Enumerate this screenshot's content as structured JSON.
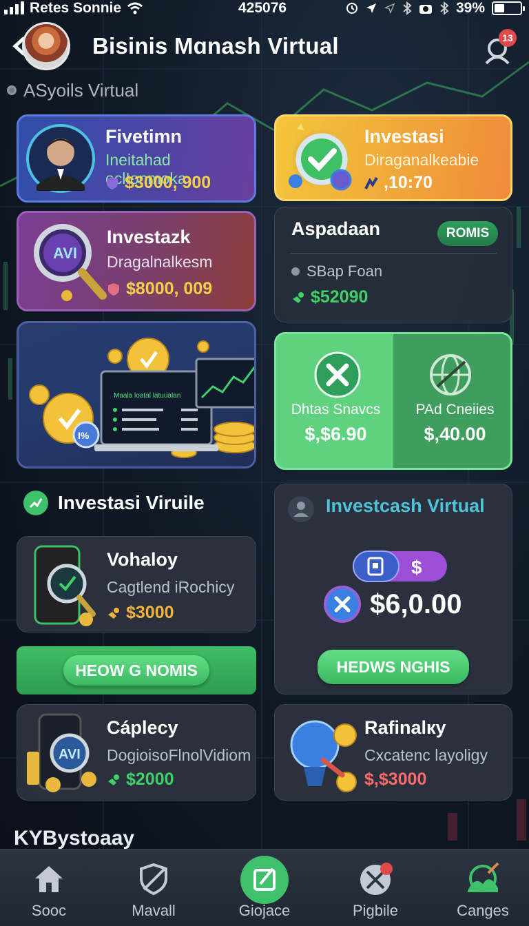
{
  "status_bar": {
    "carrier": "Retes Sonnie",
    "center": "425076",
    "battery": "39%",
    "battery_level": 0.39
  },
  "header": {
    "title": "Bisinis Mɑnash Virtual",
    "notification_count": "13"
  },
  "subheader": "ASyoils Virtual",
  "cards": {
    "profile": {
      "title": "Fivetimn",
      "subtitle": "Ineitahad eclIonmoka",
      "amount": "$3000, 900"
    },
    "investasi": {
      "title": "Investasi",
      "subtitle": "Diraganalkeabie",
      "amount": ",10:70"
    },
    "investazk": {
      "title": "Investazk",
      "subtitle": "Dragalnalkesm",
      "amount": "$8000, 009"
    },
    "aspadaan": {
      "title": "Aspadaan",
      "badge": "ROMIS",
      "subtitle": "SBap Foan",
      "amount": "$52090"
    },
    "promo": {
      "screen_title": "Maala loatal latuualan"
    },
    "split": {
      "left_label": "Dhtas Snavcs",
      "left_amount": "$,$6.90",
      "right_label": "PAd Cneiies",
      "right_amount": "$,40.00"
    },
    "vohaloy": {
      "title": "Vohaloy",
      "subtitle": "Cagtlend iRochicy",
      "amount": "$3000"
    },
    "investcash": {
      "title": "Investcash Virtual",
      "amount": "$6,0.00",
      "button": "HEDWS NGHIS"
    },
    "caplecy": {
      "title": "Cáplecy",
      "subtitle": "DogioisoFlnolVidiom",
      "amount": "$2000"
    },
    "rafinalcy": {
      "title": "Rafinalкy",
      "subtitle": "Cxcatenc layoligy",
      "amount": "$,$3000"
    }
  },
  "section": {
    "title": "Investasi Viruile"
  },
  "green_bar_button": "HEOW G NOMIS",
  "bottom_label": "KYBystoaay",
  "tabs": [
    {
      "label": "Sooc",
      "icon": "home-icon"
    },
    {
      "label": "Mavall",
      "icon": "shield-icon"
    },
    {
      "label": "Giojace",
      "icon": "edit-icon"
    },
    {
      "label": "Pigbile",
      "icon": "tools-icon"
    },
    {
      "label": "Canges",
      "icon": "landscape-icon"
    }
  ],
  "colors": {
    "accent_green": "#3fc06a",
    "accent_blue": "#4fc3d9",
    "amount_yellow": "#f4d04a",
    "amount_red": "#ff6a6a"
  }
}
